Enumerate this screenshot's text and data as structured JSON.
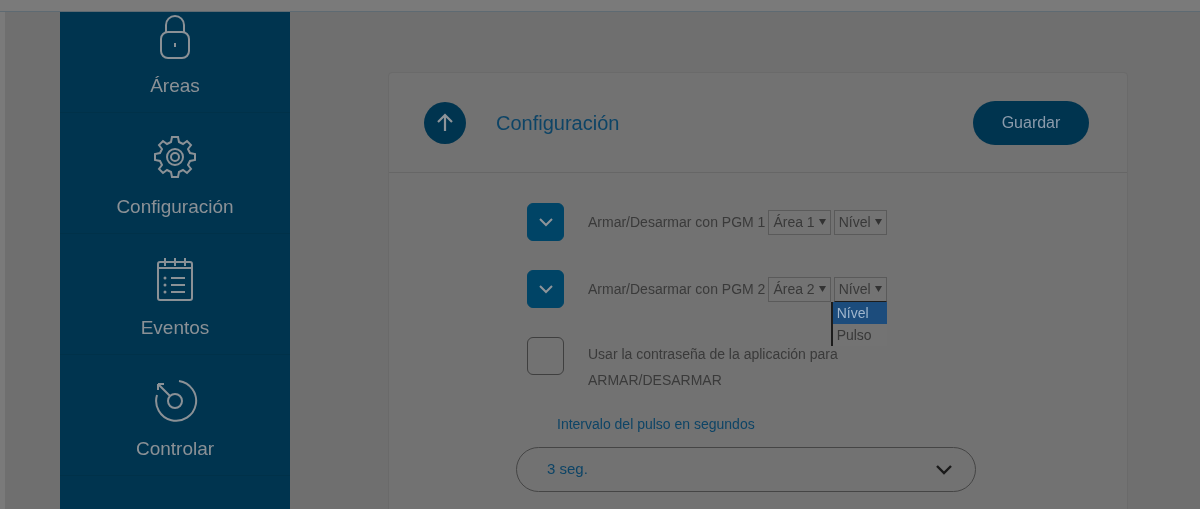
{
  "sidebar": {
    "items": [
      {
        "kind": "lock",
        "label": "Áreas",
        "selected": false
      },
      {
        "kind": "gear",
        "label": "Configuración",
        "selected": false
      },
      {
        "kind": "calendar",
        "label": "Eventos",
        "selected": false
      },
      {
        "kind": "rotate",
        "label": "Controlar",
        "selected": false
      }
    ]
  },
  "panel": {
    "title": "Configuración",
    "save_button": "Guardar",
    "options": [
      {
        "kind": "pgm",
        "label": "Armar/Desarmar con PGM 1",
        "checked": true,
        "area": "Área 1",
        "mode": "Nível",
        "expanded": false
      },
      {
        "kind": "pgm",
        "label": "Armar/Desarmar con PGM 2",
        "checked": true,
        "area": "Área 2",
        "mode": "Nível",
        "expanded": true,
        "menu": [
          {
            "label": "Nível",
            "selected": true
          },
          {
            "label": "Pulso",
            "selected": false
          }
        ]
      },
      {
        "kind": "check",
        "label": "Usar la contraseña de la aplicación para ARMAR/DESARMAR",
        "checked": false
      }
    ],
    "interval": {
      "label": "Intervalo del pulso en segundos",
      "value": "3 seg."
    }
  }
}
